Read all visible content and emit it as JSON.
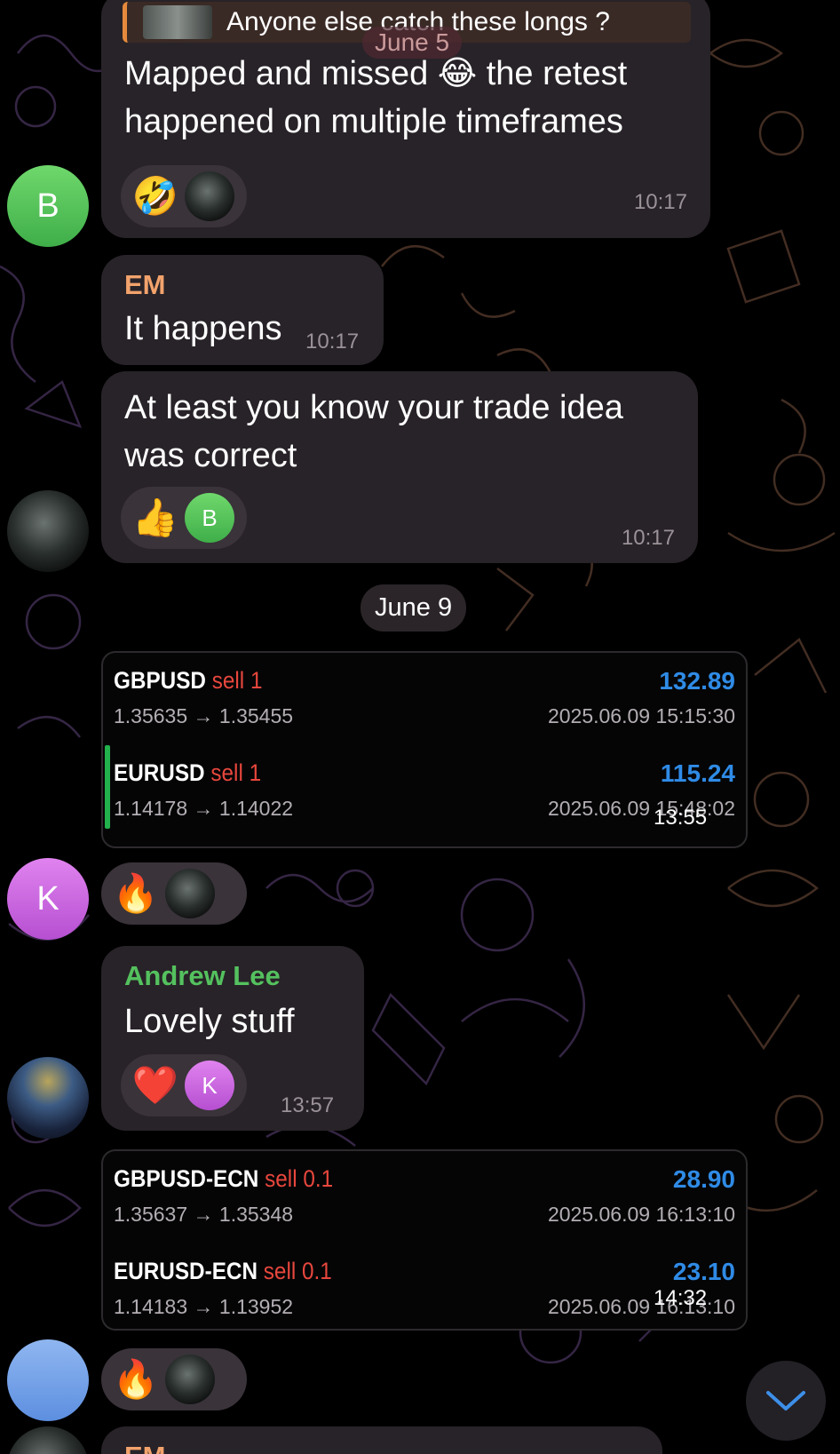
{
  "colors": {
    "accent_blue": "#2f8be6",
    "sell_red": "#e8473d",
    "em_orange": "#f2a36c",
    "andrew_green": "#54c15e"
  },
  "top_message": {
    "reply_preview": "Anyone else catch these longs ?",
    "overlay_date": "June 5",
    "text": "Mapped and missed 😂 the retest happened on multiple timeframes",
    "reactions": [
      "🤣"
    ],
    "time": "10:17"
  },
  "avatars": {
    "b": "B",
    "k": "K"
  },
  "em_messages": [
    {
      "sender": "EM",
      "text": "It happens",
      "time": "10:17"
    },
    {
      "text": "At least you know your trade idea was correct",
      "reactions": [
        "👍"
      ],
      "reactor": "B",
      "time": "10:17"
    }
  ],
  "date_separator": "June 9",
  "card1": {
    "trades": [
      {
        "symbol": "GBPUSD",
        "direction": "sell 1",
        "profit": "132.89",
        "prices": "1.35635 → 1.35455",
        "timestamp": "2025.06.09 15:15:30"
      },
      {
        "symbol": "EURUSD",
        "direction": "sell 1",
        "profit": "115.24",
        "prices": "1.14178 → 1.14022",
        "timestamp": "2025.06.09 15:48:02"
      }
    ],
    "time": "13:55",
    "reaction": "🔥"
  },
  "andrew_message": {
    "sender": "Andrew Lee",
    "text": "Lovely stuff",
    "reaction": "❤️",
    "reactor": "K",
    "time": "13:57"
  },
  "card2": {
    "trades": [
      {
        "symbol": "GBPUSD-ECN",
        "direction": "sell 0.1",
        "profit": "28.90",
        "prices": "1.35637 → 1.35348",
        "timestamp": "2025.06.09 16:13:10"
      },
      {
        "symbol": "EURUSD-ECN",
        "direction": "sell 0.1",
        "profit": "23.10",
        "prices": "1.14183 → 1.13952",
        "timestamp": "2025.06.09 16:13:10"
      }
    ],
    "time": "14:32",
    "reaction": "🔥"
  },
  "partial_sender": "EM",
  "icons": {
    "scroll_down": "chevron-down-icon"
  }
}
